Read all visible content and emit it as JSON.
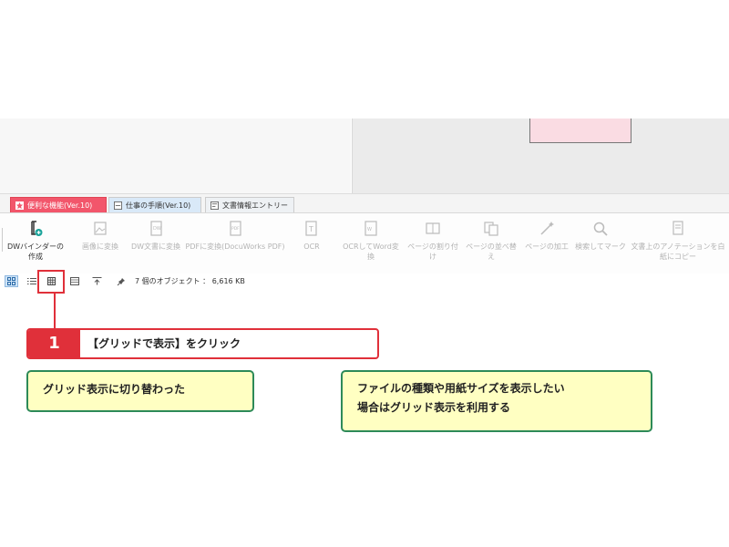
{
  "tabs": [
    {
      "label": "便利な機能(Ver.10)",
      "icon": "star-icon"
    },
    {
      "label": "仕事の手順(Ver.10)",
      "icon": "checklist-icon"
    },
    {
      "label": "文書情報エントリー",
      "icon": "doc-entry-icon"
    }
  ],
  "ribbon": {
    "binder": "DWバインダーの作成",
    "to_image": "画像に変換",
    "to_dw": "DW文書に変換",
    "pdf_to_dw": "PDFに変換(DocuWorks PDF)",
    "ocr": "OCR",
    "ocr_word": "OCRしてWord変換",
    "page_split": "ページの割り付け",
    "page_sort": "ページの並べ替え",
    "page_edit": "ページの加工",
    "search_mark": "検索してマーク",
    "copy_annotation": "文書上のアノテーションを白紙にコピー"
  },
  "status": {
    "object_count": "7 個のオブジェクト ： 6,616 KB"
  },
  "callout": {
    "number": "1",
    "text": "【グリッドで表示】をクリック"
  },
  "notes": {
    "grid_switched": "グリッド表示に切り替わった",
    "usage_line1": "ファイルの種類や用紙サイズを表示したい",
    "usage_line2": "場合はグリッド表示を利用する"
  },
  "colors": {
    "favorites_tab": "#f2566b",
    "callout_red": "#e0303a",
    "note_border": "#2d8a58",
    "note_fill": "#ffffc2",
    "thumbnail_pink": "#fadce3"
  }
}
